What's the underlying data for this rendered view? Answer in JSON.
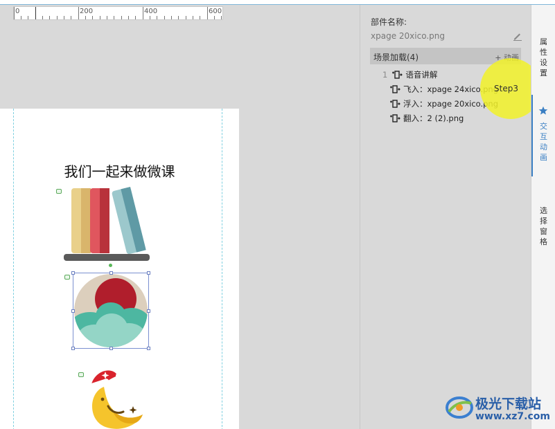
{
  "ruler": {
    "labels": [
      "0",
      "200",
      "400",
      "600"
    ]
  },
  "page": {
    "title": "我们一起来做微课"
  },
  "properties": {
    "name_label": "部件名称:",
    "name_value": "xpage 20xico.png",
    "edit_icon": "pencil-icon"
  },
  "scene": {
    "label": "场景加载(4)",
    "add_animation": "+ 动画",
    "items": [
      {
        "num": "1",
        "label": "语音讲解"
      },
      {
        "num": "",
        "label": "飞入：xpage 24xico.png"
      },
      {
        "num": "",
        "label": "浮入：xpage 20xico.png"
      },
      {
        "num": "",
        "label": "翻入：2 (2).png"
      }
    ]
  },
  "step": {
    "label": "Step3"
  },
  "tabs": [
    {
      "label": "属性设置"
    },
    {
      "label": "交互动画"
    },
    {
      "label": "选择窗格"
    }
  ],
  "watermark": {
    "text": "极光下载站",
    "url": "www.xz7.com"
  },
  "colors": {
    "accent": "#3a7fc3",
    "highlight": "#f2f22a"
  }
}
